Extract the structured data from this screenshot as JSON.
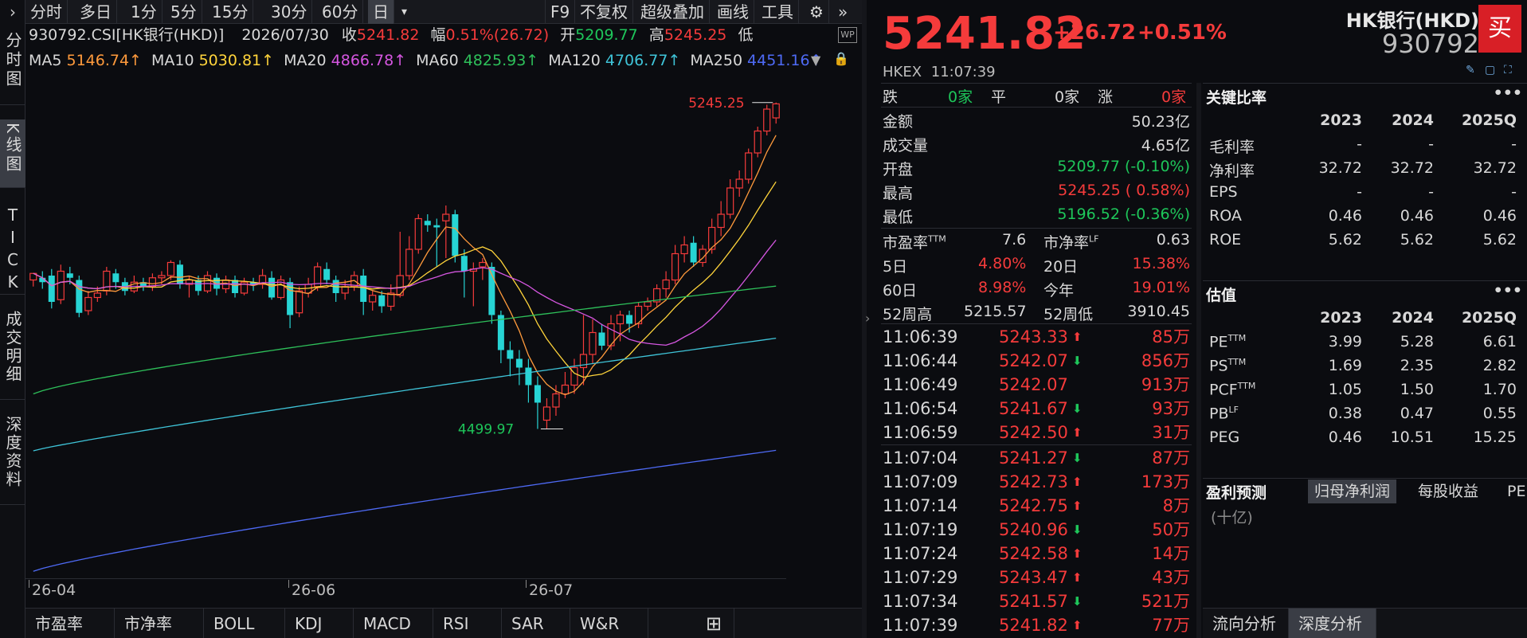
{
  "toolbar": {
    "items": [
      "分时",
      "多日",
      "1分",
      "5分",
      "15分",
      "30分",
      "60分",
      "日"
    ],
    "dropdown": "▾",
    "right_items": [
      "F9",
      "不复权",
      "超级叠加",
      "画线",
      "工具"
    ]
  },
  "vtabs": [
    "分时图",
    "K线图",
    "TICK",
    "成交明细",
    "深度资料"
  ],
  "info": {
    "code_name": "930792.CSI[HK银行(HKD)]",
    "date": "2026/07/30",
    "close_label": "收",
    "close_value": "5241.82",
    "amp_label": "幅",
    "amp_value": "0.51%(26.72)",
    "open_label": "开",
    "open_value": "5209.77",
    "high_label": "高",
    "high_value": "5245.25",
    "low_label": "低"
  },
  "ma": [
    {
      "label": "MA5",
      "value": "5146.74↑",
      "color": "#ff9a3c"
    },
    {
      "label": "MA10",
      "value": "5030.81↑",
      "color": "#ffd43b"
    },
    {
      "label": "MA20",
      "value": "4866.78↑",
      "color": "#d556e0"
    },
    {
      "label": "MA60",
      "value": "4825.93↑",
      "color": "#2ec05a"
    },
    {
      "label": "MA120",
      "value": "4706.77↑",
      "color": "#3fc4d8"
    },
    {
      "label": "MA250",
      "value": "4451.16↑",
      "color": "#4e6af5"
    }
  ],
  "chart_data": {
    "type": "candlestick",
    "yticks": [
      "5270",
      "5060",
      "4850",
      "4640",
      "4430",
      "4220"
    ],
    "xticks": [
      "26-04",
      "26-06",
      "26-07"
    ],
    "high_marker": "5245.25",
    "low_marker": "4499.97",
    "ylim": [
      4170,
      5290
    ],
    "candles": [
      [
        4840,
        4855,
        4825,
        4850
      ],
      [
        4845,
        4835,
        4820,
        4860
      ],
      [
        4850,
        4790,
        4775,
        4865
      ],
      [
        4795,
        4860,
        4785,
        4875
      ],
      [
        4855,
        4845,
        4830,
        4870
      ],
      [
        4840,
        4765,
        4755,
        4850
      ],
      [
        4770,
        4800,
        4760,
        4815
      ],
      [
        4800,
        4810,
        4790,
        4825
      ],
      [
        4815,
        4860,
        4805,
        4870
      ],
      [
        4855,
        4835,
        4820,
        4865
      ],
      [
        4835,
        4815,
        4805,
        4845
      ],
      [
        4815,
        4835,
        4810,
        4850
      ],
      [
        4835,
        4825,
        4815,
        4845
      ],
      [
        4825,
        4845,
        4815,
        4855
      ],
      [
        4845,
        4850,
        4830,
        4860
      ],
      [
        4850,
        4880,
        4840,
        4885
      ],
      [
        4875,
        4830,
        4820,
        4885
      ],
      [
        4830,
        4840,
        4800,
        4850
      ],
      [
        4840,
        4815,
        4805,
        4850
      ],
      [
        4815,
        4850,
        4810,
        4860
      ],
      [
        4845,
        4820,
        4805,
        4855
      ],
      [
        4820,
        4840,
        4810,
        4850
      ],
      [
        4840,
        4810,
        4800,
        4850
      ],
      [
        4810,
        4835,
        4805,
        4845
      ],
      [
        4835,
        4830,
        4815,
        4845
      ],
      [
        4830,
        4850,
        4820,
        4865
      ],
      [
        4845,
        4800,
        4795,
        4860
      ],
      [
        4800,
        4840,
        4795,
        4850
      ],
      [
        4835,
        4760,
        4730,
        4845
      ],
      [
        4765,
        4815,
        4755,
        4825
      ],
      [
        4810,
        4830,
        4800,
        4845
      ],
      [
        4825,
        4870,
        4815,
        4880
      ],
      [
        4865,
        4840,
        4830,
        4880
      ],
      [
        4840,
        4810,
        4790,
        4850
      ],
      [
        4810,
        4825,
        4795,
        4840
      ],
      [
        4825,
        4850,
        4815,
        4860
      ],
      [
        4850,
        4790,
        4760,
        4865
      ],
      [
        4790,
        4805,
        4770,
        4815
      ],
      [
        4805,
        4780,
        4765,
        4815
      ],
      [
        4780,
        4810,
        4770,
        4830
      ],
      [
        4805,
        4850,
        4800,
        4950
      ],
      [
        4850,
        4910,
        4840,
        4940
      ],
      [
        4910,
        4980,
        4900,
        4990
      ],
      [
        4975,
        4965,
        4950,
        4990
      ],
      [
        4965,
        4960,
        4870,
        4980
      ],
      [
        4975,
        4990,
        4890,
        5010
      ],
      [
        4990,
        4895,
        4880,
        5000
      ],
      [
        4895,
        4860,
        4800,
        4910
      ],
      [
        4860,
        4865,
        4780,
        4880
      ],
      [
        4870,
        4880,
        4840,
        4890
      ],
      [
        4870,
        4760,
        4740,
        4880
      ],
      [
        4760,
        4680,
        4650,
        4770
      ],
      [
        4680,
        4660,
        4620,
        4700
      ],
      [
        4660,
        4640,
        4600,
        4680
      ],
      [
        4640,
        4600,
        4560,
        4660
      ],
      [
        4600,
        4560,
        4500,
        4620
      ],
      [
        4520,
        4550,
        4500,
        4570
      ],
      [
        4550,
        4580,
        4530,
        4600
      ],
      [
        4580,
        4600,
        4570,
        4630
      ],
      [
        4600,
        4640,
        4580,
        4660
      ],
      [
        4640,
        4670,
        4600,
        4760
      ],
      [
        4670,
        4720,
        4650,
        4750
      ],
      [
        4720,
        4690,
        4680,
        4740
      ],
      [
        4690,
        4740,
        4680,
        4760
      ],
      [
        4740,
        4760,
        4700,
        4770
      ],
      [
        4760,
        4740,
        4720,
        4770
      ],
      [
        4740,
        4780,
        4730,
        4790
      ],
      [
        4780,
        4790,
        4770,
        4800
      ],
      [
        4790,
        4820,
        4780,
        4830
      ],
      [
        4820,
        4840,
        4800,
        4860
      ],
      [
        4840,
        4900,
        4830,
        4920
      ],
      [
        4900,
        4920,
        4880,
        4940
      ],
      [
        4925,
        4880,
        4870,
        4940
      ],
      [
        4880,
        4910,
        4870,
        4920
      ],
      [
        4910,
        4960,
        4900,
        4980
      ],
      [
        4960,
        4990,
        4940,
        5020
      ],
      [
        4990,
        5050,
        4980,
        5070
      ],
      [
        5050,
        5070,
        5030,
        5090
      ],
      [
        5070,
        5130,
        5060,
        5140
      ],
      [
        5130,
        5180,
        5120,
        5190
      ],
      [
        5180,
        5230,
        5170,
        5240
      ],
      [
        5210,
        5242,
        5197,
        5245
      ]
    ]
  },
  "bottom_tabs": [
    "市盈率",
    "市净率",
    "BOLL",
    "KDJ",
    "MACD",
    "RSI",
    "SAR",
    "W&R",
    "⊞"
  ],
  "quote": {
    "price": "5241.82",
    "change": "+26.72",
    "pct": "+0.51%",
    "name": "HK银行(HKD)",
    "code": "930792",
    "buy": "买",
    "exchange": "HKEX",
    "time": "11:07:39"
  },
  "stats": {
    "fall_label": "跌",
    "fall_value": "0家",
    "flat_label": "平",
    "flat_value": "0家",
    "rise_label": "涨",
    "rise_value": "0家",
    "amount_label": "金额",
    "amount_value": "50.23亿",
    "volume_label": "成交量",
    "volume_value": "4.65亿",
    "open_label": "开盘",
    "open_value": "5209.77 (-0.10%)",
    "high_label": "最高",
    "high_value": "5245.25 ( 0.58%)",
    "low_label": "最低",
    "low_value": "5196.52 (-0.36%)",
    "pe_label": "市盈率",
    "pe_sup": "TTM",
    "pe_value": "7.6",
    "pb_label": "市净率",
    "pb_sup": "LF",
    "pb_value": "0.63",
    "d5_label": "5日",
    "d5_value": "4.80%",
    "d20_label": "20日",
    "d20_value": "15.38%",
    "d60_label": "60日",
    "d60_value": "8.98%",
    "ytd_label": "今年",
    "ytd_value": "19.01%",
    "w52h_label": "52周高",
    "w52h_value": "5215.57",
    "w52l_label": "52周低",
    "w52l_value": "3910.45"
  },
  "ticks": [
    {
      "t": "11:06:39",
      "p": "5243.33",
      "d": "up",
      "v": "85万"
    },
    {
      "t": "11:06:44",
      "p": "5242.07",
      "d": "down",
      "v": "856万"
    },
    {
      "t": "11:06:49",
      "p": "5242.07",
      "d": "",
      "v": "913万"
    },
    {
      "t": "11:06:54",
      "p": "5241.67",
      "d": "down",
      "v": "93万"
    },
    {
      "t": "11:06:59",
      "p": "5242.50",
      "d": "up",
      "v": "31万"
    },
    {
      "t": "11:07:04",
      "p": "5241.27",
      "d": "down",
      "v": "87万"
    },
    {
      "t": "11:07:09",
      "p": "5242.73",
      "d": "up",
      "v": "173万"
    },
    {
      "t": "11:07:14",
      "p": "5242.75",
      "d": "up",
      "v": "8万"
    },
    {
      "t": "11:07:19",
      "p": "5240.96",
      "d": "down",
      "v": "50万"
    },
    {
      "t": "11:07:24",
      "p": "5242.58",
      "d": "up",
      "v": "14万"
    },
    {
      "t": "11:07:29",
      "p": "5243.47",
      "d": "up",
      "v": "43万"
    },
    {
      "t": "11:07:34",
      "p": "5241.57",
      "d": "down",
      "v": "521万"
    },
    {
      "t": "11:07:39",
      "p": "5241.82",
      "d": "up",
      "v": "77万"
    }
  ],
  "ratios": {
    "title": "关键比率",
    "more": "•••",
    "years": [
      "2023",
      "2024",
      "2025Q"
    ],
    "rows": [
      {
        "label": "毛利率",
        "sup": "",
        "v": [
          "-",
          "-",
          "-"
        ]
      },
      {
        "label": "净利率",
        "sup": "",
        "v": [
          "32.72",
          "32.72",
          "32.72"
        ]
      },
      {
        "label": "EPS",
        "sup": "",
        "v": [
          "-",
          "-",
          "-"
        ]
      },
      {
        "label": "ROA",
        "sup": "",
        "v": [
          "0.46",
          "0.46",
          "0.46"
        ]
      },
      {
        "label": "ROE",
        "sup": "",
        "v": [
          "5.62",
          "5.62",
          "5.62"
        ]
      }
    ]
  },
  "valuation": {
    "title": "估值",
    "more": "•••",
    "years": [
      "2023",
      "2024",
      "2025Q"
    ],
    "rows": [
      {
        "label": "PE",
        "sup": "TTM",
        "v": [
          "3.99",
          "5.28",
          "6.61"
        ]
      },
      {
        "label": "PS",
        "sup": "TTM",
        "v": [
          "1.69",
          "2.35",
          "2.82"
        ]
      },
      {
        "label": "PCF",
        "sup": "TTM",
        "v": [
          "1.05",
          "1.50",
          "1.70"
        ]
      },
      {
        "label": "PB",
        "sup": "LF",
        "v": [
          "0.38",
          "0.47",
          "0.55"
        ]
      },
      {
        "label": "PEG",
        "sup": "",
        "v": [
          "0.46",
          "10.51",
          "15.25"
        ]
      }
    ]
  },
  "forecast": {
    "title": "盈利预测",
    "tabs": [
      "归母净利润",
      "每股收益",
      "PE"
    ],
    "unit": "(十亿)"
  },
  "right_bottom_tabs": [
    "流向分析",
    "深度分析"
  ]
}
